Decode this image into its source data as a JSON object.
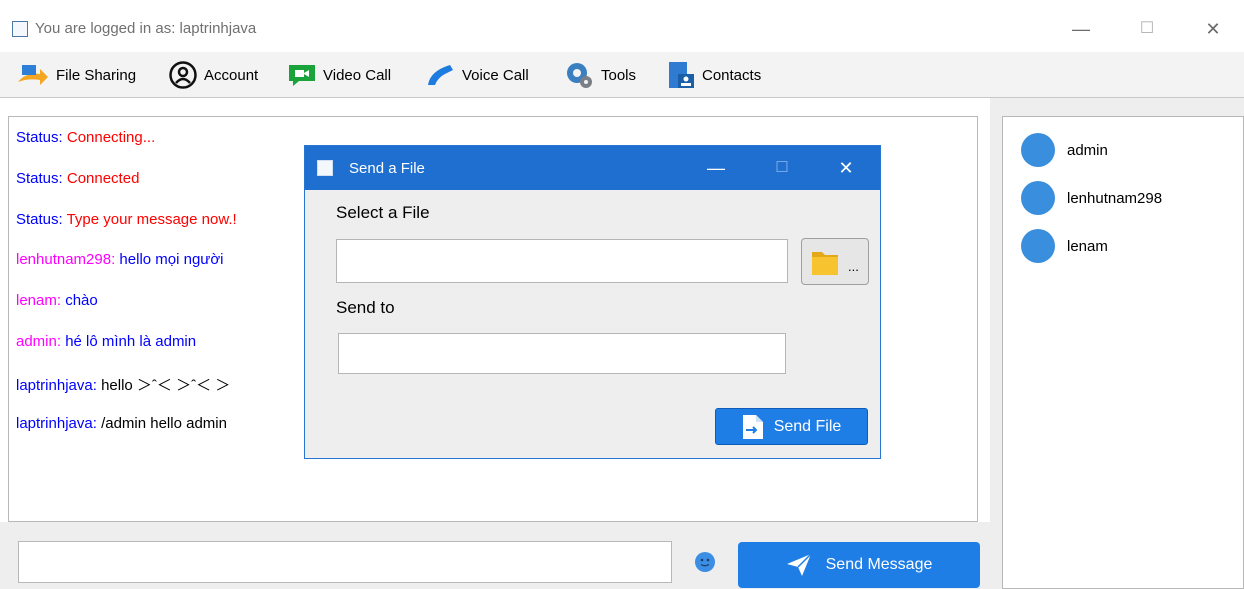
{
  "window": {
    "title": "You are logged in as: laptrinhjava",
    "minimize": "—",
    "maximize": "☐",
    "close": "✕"
  },
  "menu": {
    "items": [
      {
        "label": "File Sharing",
        "icon": "file-sharing-icon"
      },
      {
        "label": "Account",
        "icon": "account-icon"
      },
      {
        "label": "Video Call",
        "icon": "video-call-icon"
      },
      {
        "label": "Voice Call",
        "icon": "voice-call-icon"
      },
      {
        "label": "Tools",
        "icon": "gear-icon"
      },
      {
        "label": "Contacts",
        "icon": "contacts-icon"
      }
    ]
  },
  "chat": {
    "messages": [
      {
        "prefix": "Status: ",
        "text": "Connecting..."
      },
      {
        "prefix": "Status: ",
        "text": "Connected"
      },
      {
        "prefix": "Status: ",
        "text": "Type your message now.!"
      },
      {
        "prefix": "lenhutnam298: ",
        "text": "hello mọi người"
      },
      {
        "prefix": "lenam: ",
        "text": "chào"
      },
      {
        "prefix": "admin: ",
        "text": "hé lô mình là admin"
      },
      {
        "prefix": "laptrinhjava: ",
        "text": "hello ＞ˆ＜ ＞ˆ＜ ＞"
      },
      {
        "prefix": "laptrinhjava: ",
        "text": "/admin hello admin"
      }
    ]
  },
  "composer": {
    "input_value": "",
    "send_label": "Send Message"
  },
  "users": [
    {
      "name": "admin"
    },
    {
      "name": "lenhutnam298"
    },
    {
      "name": "lenam"
    }
  ],
  "dialog": {
    "title": "Send a File",
    "minimize": "—",
    "maximize": "☐",
    "close": "✕",
    "select_label": "Select a File",
    "file_value": "",
    "browse_dots": "...",
    "send_to_label": "Send to",
    "send_to_value": "",
    "send_file_label": "Send File"
  },
  "colors": {
    "accent": "#1f7de6",
    "status_prefix": "#0000ff",
    "status_text": "#ff0000",
    "user_other": "#ff00ff",
    "user_self": "#0000ff"
  }
}
